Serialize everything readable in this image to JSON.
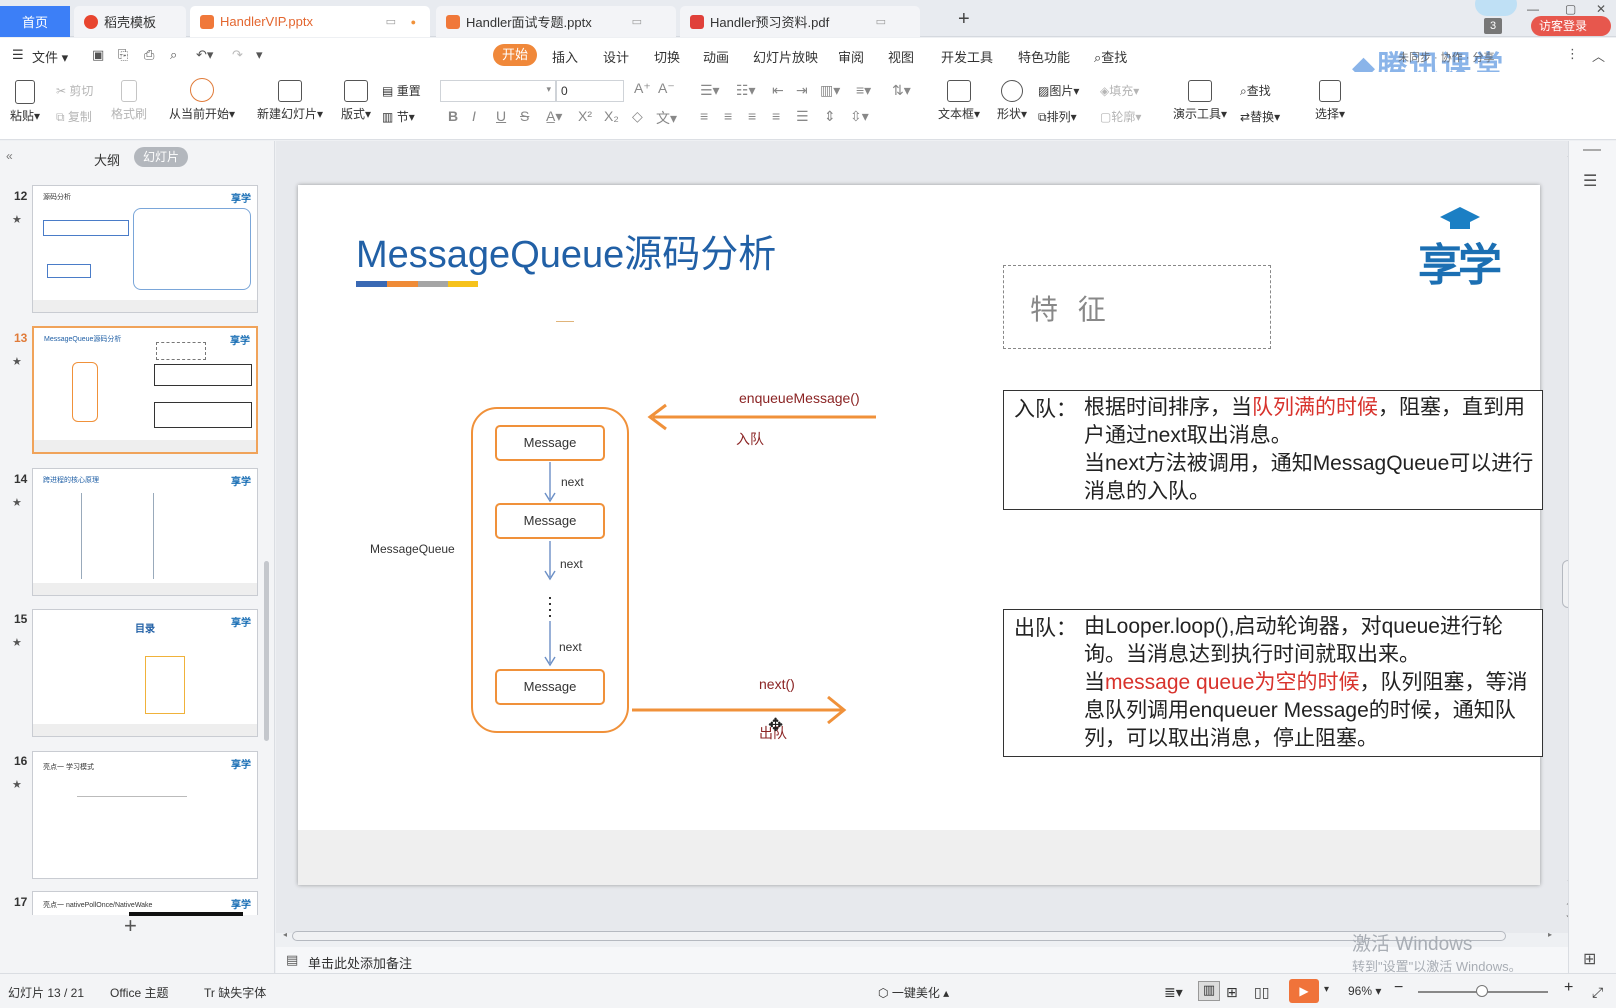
{
  "tabs": {
    "home": "首页",
    "daoke": "稻壳模板",
    "handlervip": "HandlerVIP.pptx",
    "interview": "Handler面试专题.pptx",
    "preview": "Handler预习资料.pdf",
    "add": "+",
    "badge": "3",
    "login": "访客登录"
  },
  "menu": {
    "file": "文件",
    "tabs": [
      "开始",
      "插入",
      "设计",
      "切换",
      "动画",
      "幻灯片放映",
      "审阅",
      "视图",
      "开发工具",
      "特色功能",
      "查找"
    ],
    "watermark_logo": "腾讯课堂",
    "watermark_sub": "未同步 · 协作 · 分享"
  },
  "ribbon": {
    "paste": "粘贴",
    "cut": "剪切",
    "copy": "复制",
    "format_painter": "格式刷",
    "from_current": "从当前开始",
    "new_slide": "新建幻灯片",
    "layout": "版式",
    "reset": "重置",
    "section": "节",
    "font_size": "0",
    "textbox": "文本框",
    "shape": "形状",
    "picture": "图片",
    "arrange": "排列",
    "fill": "填充",
    "outline": "轮廓",
    "present_tools": "演示工具",
    "find": "查找",
    "replace": "替换",
    "select": "选择"
  },
  "leftpane": {
    "outline_tab": "大纲",
    "slides_tab": "幻灯片",
    "thumbs": [
      {
        "num": "12",
        "title": "源码分析"
      },
      {
        "num": "13",
        "title": "MessageQueue源码分析"
      },
      {
        "num": "14",
        "title": "跨进程的核心原理"
      },
      {
        "num": "15",
        "title": "目录"
      },
      {
        "num": "16",
        "title": "亮点一  学习模式"
      },
      {
        "num": "17",
        "title": "亮点一  nativePollOnce/NativeWake"
      }
    ],
    "logo": "享学",
    "add": "+"
  },
  "slide": {
    "title": "MessageQueue源码分析",
    "logo": "享学",
    "feature_label": "特 征",
    "queue_label": "MessageQueue",
    "message": "Message",
    "next": "next",
    "enqueue_call": "enqueueMessage()",
    "enqueue_label": "入队",
    "dequeue_call": "next()",
    "dequeue_label": "出队",
    "in_label": "入队：",
    "in_text_1": "根据时间排序，当",
    "in_text_red": "队列满的时候",
    "in_text_2": "，阻塞，直到用户通过next取出消息。",
    "in_text_3": "当next方法被调用，通知MessagQueue可以进行消息的入队。",
    "out_label": "出队：",
    "out_text_1": "由Looper.loop(),启动轮询器，对queue进行轮询。当消息达到执行时间就取出来。",
    "out_text_2a": "当",
    "out_text_red": "message queue为空的时候",
    "out_text_2b": "，队列阻塞，等消息队列调用enqueuer Message的时候，通知队列，可以取出消息，停止阻塞。"
  },
  "notes": "单击此处添加备注",
  "status": {
    "slide_index": "幻灯片 13 / 21",
    "theme": "Office 主题",
    "missing_font": "缺失字体",
    "beautify": "一键美化",
    "zoom": "96%",
    "activate_1": "激活 Windows",
    "activate_2": "转到\"设置\"以激活 Windows。"
  },
  "colors": {
    "accent_orange": "#f0913a",
    "title_blue": "#2160a6",
    "tab_blue": "#3c7ff7"
  }
}
